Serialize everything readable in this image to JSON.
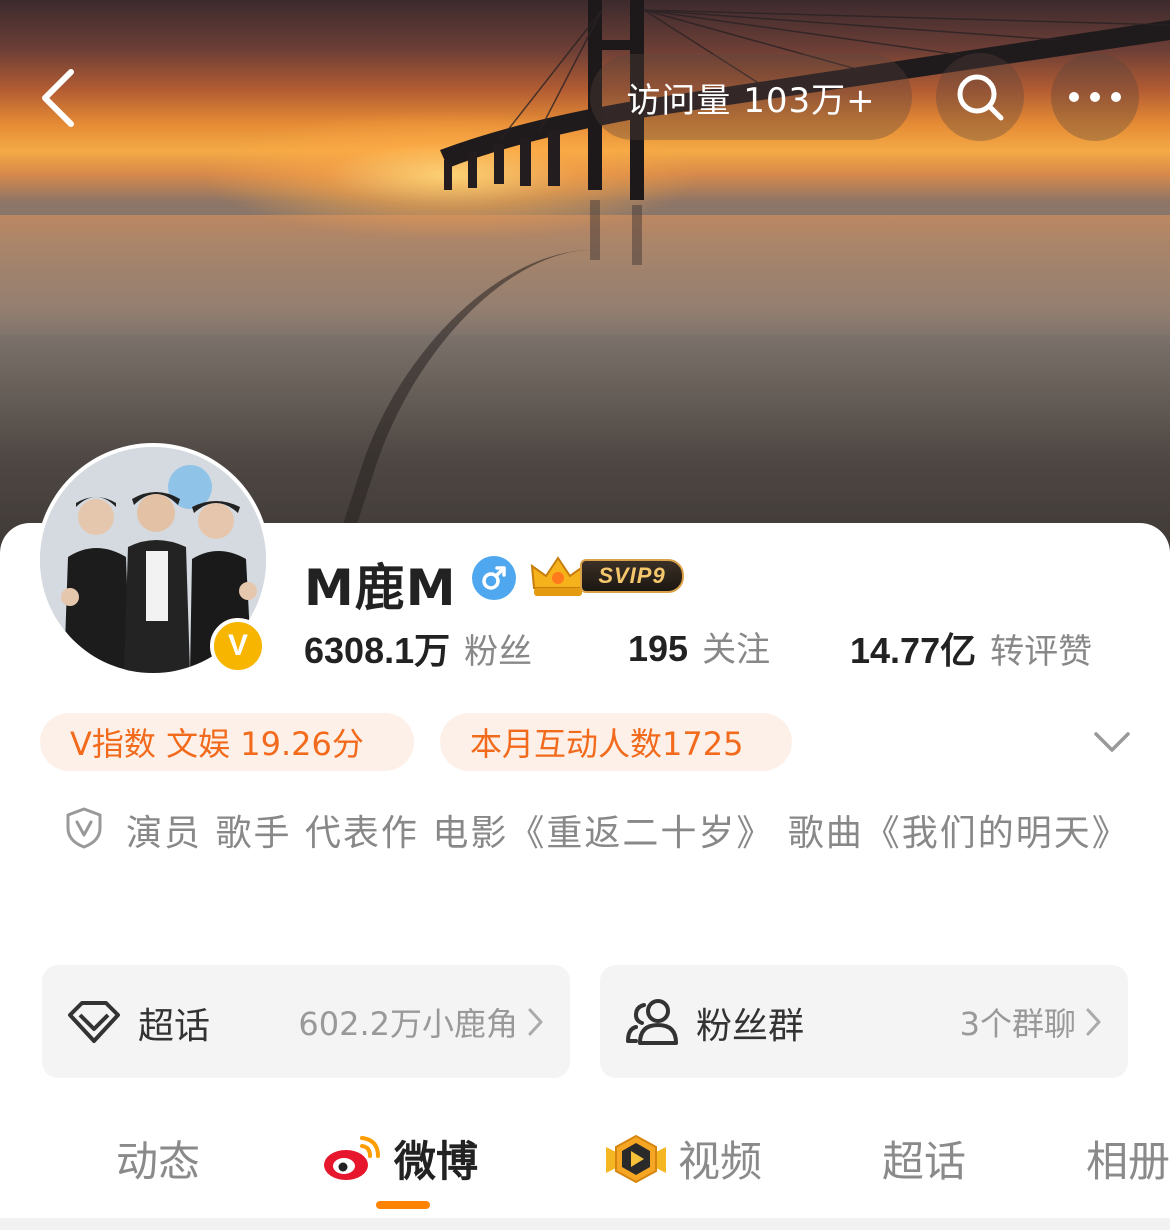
{
  "header": {
    "visits_label": "访问量 103万+"
  },
  "profile": {
    "name": "M鹿M",
    "gender": "male",
    "vip_label": "SVIP9",
    "verified_badge": "V",
    "stats": [
      {
        "value": "6308.1万",
        "label": "粉丝"
      },
      {
        "value": "195",
        "label": "关注"
      },
      {
        "value": "14.77亿",
        "label": "转评赞"
      }
    ],
    "chips": [
      {
        "label": "V指数 文娱 19.26分"
      },
      {
        "label": "本月互动人数1725"
      }
    ],
    "verification": "演员 歌手 代表作 电影《重返二十岁》 歌曲《我们的明天》"
  },
  "boxes": {
    "supertopic": {
      "title": "超话",
      "sub": "602.2万小鹿角"
    },
    "fangroup": {
      "title": "粉丝群",
      "sub": "3个群聊"
    }
  },
  "tabs": [
    {
      "label": "动态",
      "active": false
    },
    {
      "label": "微博",
      "active": true
    },
    {
      "label": "视频",
      "active": false
    },
    {
      "label": "超话",
      "active": false
    },
    {
      "label": "相册",
      "active": false
    }
  ],
  "colors": {
    "accent_orange": "#ff8200",
    "chip_text": "#f26b1d",
    "chip_bg": "#fdf0e8",
    "gender_blue": "#4fa8ef",
    "verified_gold": "#f7b500"
  },
  "icons": [
    "back-arrow-icon",
    "search-icon",
    "more-icon",
    "male-icon",
    "svip-crown-icon",
    "verified-v-icon",
    "chevron-down-icon",
    "verify-shield-icon",
    "diamond-icon",
    "fan-group-icon",
    "chevron-right-icon",
    "weibo-logo-icon",
    "video-badge-icon"
  ]
}
